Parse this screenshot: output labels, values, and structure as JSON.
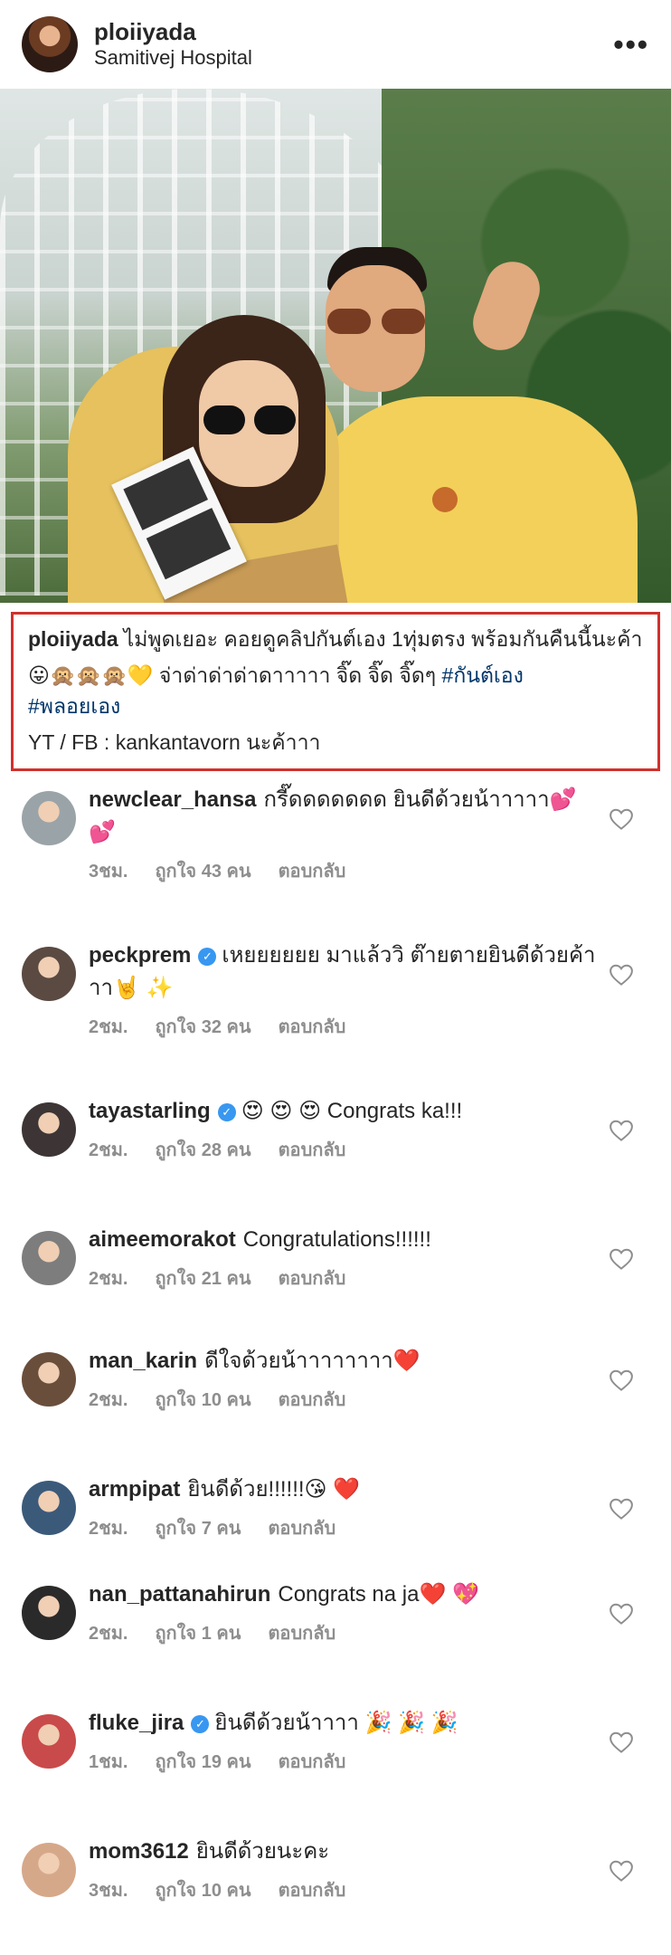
{
  "post": {
    "username": "ploiiyada",
    "location": "Samitivej Hospital",
    "more_icon": "more-horizontal-icon"
  },
  "caption": {
    "username": "ploiiyada",
    "line1": "ไม่พูดเยอะ คอยดูคลิปกันต์เอง 1ทุ่มตรง  พร้อมกันคืนนี้นะค้า",
    "emojis": "😛🙊🙊🙊💛",
    "line2": " จ่าด่าด่าด่าดาาาาา จิ๊ด จิ๊ด จิ๊ดๆ ",
    "hashtag1": "#กันต์เอง",
    "hashtag2": "#พลอยเอง",
    "line3": "YT / FB : kankantavorn นะค้าาา"
  },
  "comments": [
    {
      "user": "newclear_hansa",
      "verified": false,
      "text": "กรี๊ดดดดดดด ยินดีด้วยน้าาาาา💕 💕",
      "time": "3ชม.",
      "likes": "ถูกใจ 43 คน",
      "reply": "ตอบกลับ",
      "avatar_color": "#9aa4a8"
    },
    {
      "user": "peckprem",
      "verified": true,
      "text": "เหยยยยยย มาแล้ววิ ต๊ายตายยินดีด้วยค้าาา🤘 ✨",
      "time": "2ชม.",
      "likes": "ถูกใจ 32 คน",
      "reply": "ตอบกลับ",
      "avatar_color": "#5a4a42"
    },
    {
      "user": "tayastarling",
      "verified": true,
      "text": "😍 😍 😍  Congrats ka!!!",
      "time": "2ชม.",
      "likes": "ถูกใจ 28 คน",
      "reply": "ตอบกลับ",
      "avatar_color": "#3d3535"
    },
    {
      "user": "aimeemorakot",
      "verified": false,
      "text": "Congratulations!!!!!!",
      "time": "2ชม.",
      "likes": "ถูกใจ 21 คน",
      "reply": "ตอบกลับ",
      "avatar_color": "#7d7d7d"
    },
    {
      "user": "man_karin",
      "verified": false,
      "text": "ดีใจด้วยน้าาาาาาาา❤️",
      "time": "2ชม.",
      "likes": "ถูกใจ 10 คน",
      "reply": "ตอบกลับ",
      "avatar_color": "#6a4e3c"
    },
    {
      "user": "armpipat",
      "verified": false,
      "text": "ยินดีด้วย!!!!!!😘 ❤️",
      "time": "2ชม.",
      "likes": "ถูกใจ 7 คน",
      "reply": "ตอบกลับ",
      "avatar_color": "#3b5a7a"
    },
    {
      "user": "nan_pattanahirun",
      "verified": false,
      "text": "Congrats na ja❤️ 💖",
      "time": "2ชม.",
      "likes": "ถูกใจ 1 คน",
      "reply": "ตอบกลับ",
      "avatar_color": "#2a2a2a"
    },
    {
      "user": "fluke_jira",
      "verified": true,
      "text": "ยินดีด้วยน้าาาา 🎉 🎉 🎉",
      "time": "1ชม.",
      "likes": "ถูกใจ 19 คน",
      "reply": "ตอบกลับ",
      "avatar_color": "#c94a4a"
    },
    {
      "user": "mom3612",
      "verified": false,
      "text": "ยินดีด้วยนะคะ",
      "time": "3ชม.",
      "likes": "ถูกใจ 10 คน",
      "reply": "ตอบกลับ",
      "avatar_color": "#d6a88a"
    }
  ]
}
